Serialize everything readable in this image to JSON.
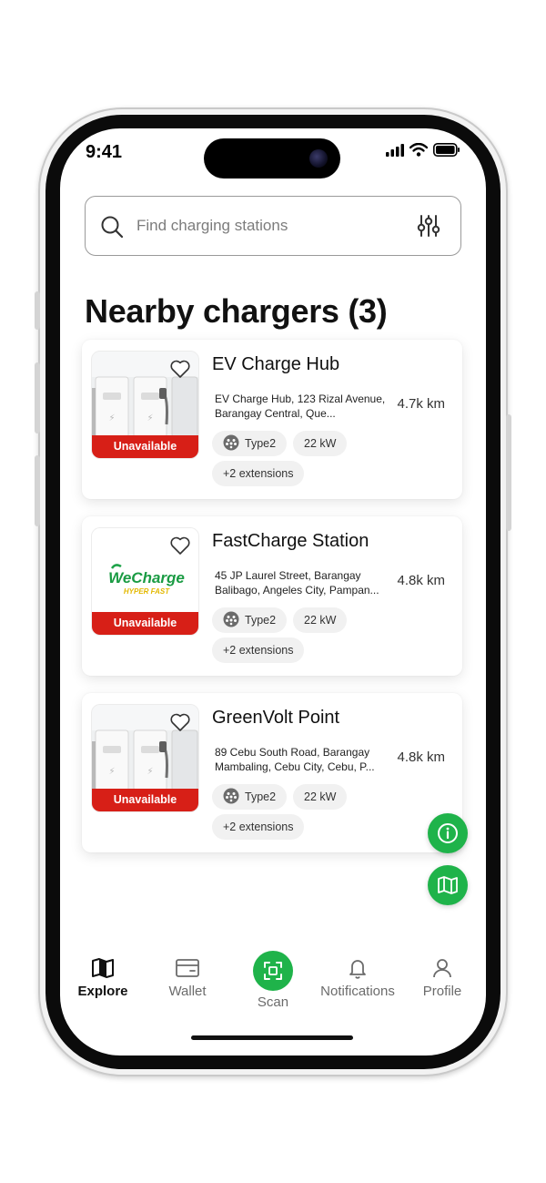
{
  "status_bar": {
    "time": "9:41"
  },
  "search": {
    "placeholder": "Find charging stations"
  },
  "section_title": "Nearby chargers (3)",
  "stations": [
    {
      "name": "EV Charge Hub",
      "address": "EV Charge Hub, 123 Rizal Avenue, Barangay Central, Que...",
      "distance": "4.7k km",
      "status": "Unavailable",
      "connector": "Type2",
      "power": "22 kW",
      "extensions": "+2 extensions",
      "image": "charger-photo"
    },
    {
      "name": "FastCharge Station",
      "address": "45 JP Laurel Street, Barangay Balibago, Angeles City, Pampan...",
      "distance": "4.8k km",
      "status": "Unavailable",
      "connector": "Type2",
      "power": "22 kW",
      "extensions": "+2 extensions",
      "image": "wecharge-logo",
      "logo_text": "WeCharge",
      "logo_subtext": "HYPER FAST"
    },
    {
      "name": "GreenVolt Point",
      "address": "89 Cebu South Road, Barangay Mambaling, Cebu City, Cebu, P...",
      "distance": "4.8k km",
      "status": "Unavailable",
      "connector": "Type2",
      "power": "22 kW",
      "extensions": "+2 extensions",
      "image": "charger-photo"
    }
  ],
  "tabbar": {
    "items": [
      {
        "label": "Explore",
        "icon": "map-book-icon",
        "active": true
      },
      {
        "label": "Wallet",
        "icon": "wallet-icon",
        "active": false
      },
      {
        "label": "Scan",
        "icon": "scan-icon",
        "active": false
      },
      {
        "label": "Notifications",
        "icon": "bell-icon",
        "active": false
      },
      {
        "label": "Profile",
        "icon": "person-icon",
        "active": false
      }
    ]
  },
  "colors": {
    "accent_green": "#1fb34a",
    "unavailable_red": "#d71f17",
    "chip_bg": "#f1f1f1"
  }
}
